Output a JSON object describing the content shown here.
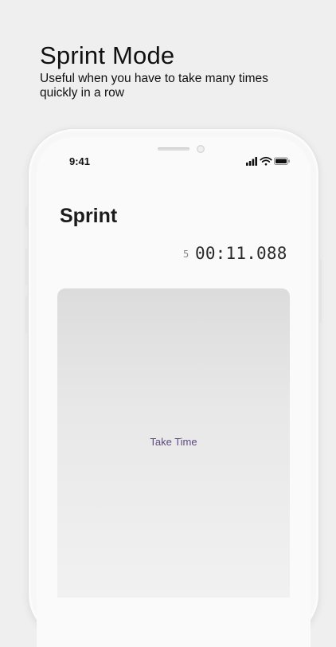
{
  "promo": {
    "title": "Sprint Mode",
    "subtitle": "Useful when you have to take many times quickly in a row"
  },
  "status_bar": {
    "time": "9:41",
    "icons": [
      "cellular-signal-icon",
      "wifi-icon",
      "battery-icon"
    ]
  },
  "screen": {
    "title": "Sprint",
    "lap_count": "5",
    "timer": "00:11.088",
    "take_time_label": "Take Time"
  },
  "colors": {
    "background": "#efefef",
    "accent": "#5e4a7d",
    "text": "#1c1c1e"
  }
}
